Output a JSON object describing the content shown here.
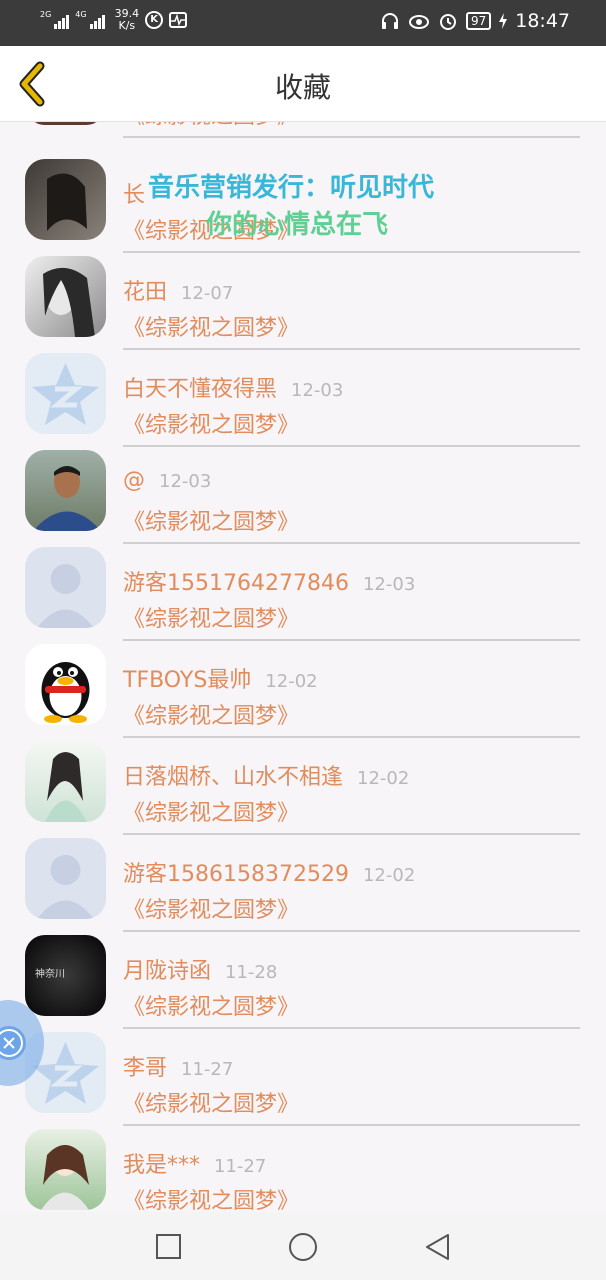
{
  "status_bar": {
    "net1": "2G",
    "net2": "4G",
    "speed_value": "39.4",
    "speed_unit": "K/s",
    "battery": "97",
    "time": "18:47",
    "icons": [
      "signal-icon",
      "signal-icon",
      "k-icon",
      "pulse-icon",
      "headphone-icon",
      "eye-icon",
      "alarm-icon",
      "battery-icon",
      "charging-icon"
    ]
  },
  "header": {
    "title": "收藏",
    "back_icon": "chevron-left-icon",
    "accent": "#e6b800"
  },
  "overlay": {
    "line1": "音乐营销发行：听见时代",
    "line2": "你的心情总在飞"
  },
  "items": [
    {
      "name": "",
      "date": "",
      "work": "《综影视之圆梦》",
      "avatar": "photo-girl"
    },
    {
      "name": "长",
      "date": "",
      "work": "《综影视之圆梦》",
      "avatar": "photo-girl-dark"
    },
    {
      "name": "花田",
      "date": "12-07",
      "work": "《综影视之圆梦》",
      "avatar": "photo-bw"
    },
    {
      "name": "白天不懂夜得黑",
      "date": "12-03",
      "work": "《综影视之圆梦》",
      "avatar": "qzone-icon"
    },
    {
      "name": "@",
      "date": "12-03",
      "work": "《综影视之圆梦》",
      "avatar": "photo-man"
    },
    {
      "name": "游客1551764277846",
      "date": "12-03",
      "work": "《综影视之圆梦》",
      "avatar": "default-user-icon"
    },
    {
      "name": "TFBOYS最帅",
      "date": "12-02",
      "work": "《综影视之圆梦》",
      "avatar": "qq-penguin-icon"
    },
    {
      "name": "日落烟桥、山水不相逢",
      "date": "12-02",
      "work": "《综影视之圆梦》",
      "avatar": "photo-anime"
    },
    {
      "name": "游客1586158372529",
      "date": "12-02",
      "work": "《综影视之圆梦》",
      "avatar": "default-user-icon"
    },
    {
      "name": "月陇诗函",
      "date": "11-28",
      "work": "《综影视之圆梦》",
      "avatar": "dark-text"
    },
    {
      "name": "李哥",
      "date": "11-27",
      "work": "《综影视之圆梦》",
      "avatar": "qzone-icon"
    },
    {
      "name": "我是***",
      "date": "11-27",
      "work": "《综影视之圆梦》",
      "avatar": "photo-anime-girl"
    }
  ],
  "avatar_text": {
    "dark_text": "神奈川"
  },
  "float_button": {
    "icon": "close-icon"
  },
  "nav": {
    "recent": "square-icon",
    "home": "circle-icon",
    "back": "triangle-back-icon"
  },
  "colors": {
    "name": "#e28c5c",
    "date": "#b8b8b8",
    "overlay1": "#38b7d8",
    "overlay2": "#5fcf94"
  }
}
